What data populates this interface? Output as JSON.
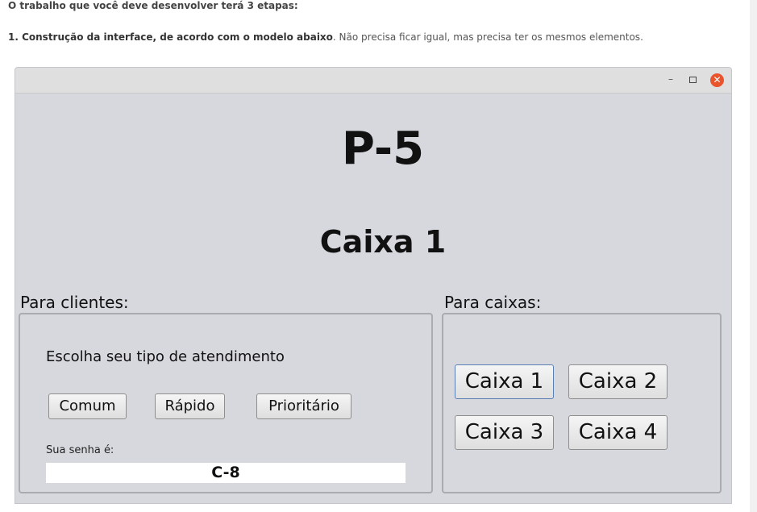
{
  "document": {
    "intro": "O trabalho que você deve desenvolver terá 3 etapas:",
    "step1_bold": "1. Construção da interface, de acordo com o modelo abaixo",
    "step1_rest": ". Não precisa ficar igual, mas precisa ter os mesmos elementos."
  },
  "window": {
    "minimize_glyph": "–",
    "close_glyph": "✕",
    "current_ticket": "P-5",
    "current_caixa": "Caixa 1",
    "clients": {
      "label": "Para clientes:",
      "prompt": "Escolha seu tipo de atendimento",
      "buttons": [
        "Comum",
        "Rápido",
        "Prioritário"
      ],
      "senha_label": "Sua senha é:",
      "senha_value": "C-8"
    },
    "caixas": {
      "label": "Para caixas:",
      "buttons": [
        "Caixa 1",
        "Caixa 2",
        "Caixa 3",
        "Caixa 4"
      ]
    }
  }
}
